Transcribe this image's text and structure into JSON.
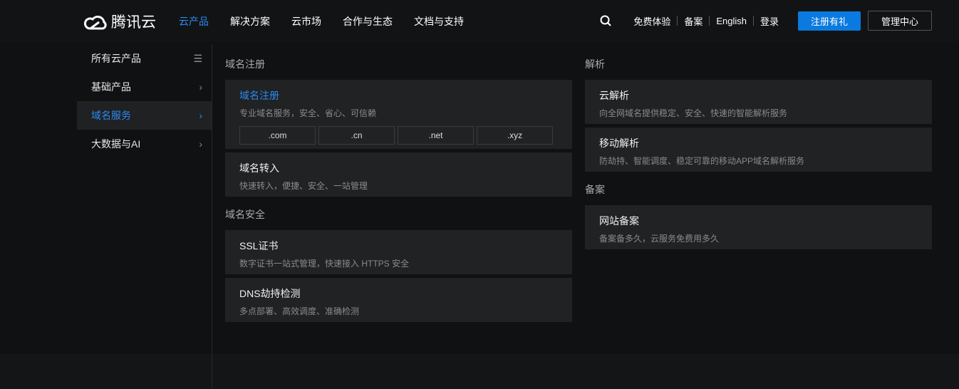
{
  "header": {
    "logo_text": "腾讯云",
    "nav": [
      "云产品",
      "解决方案",
      "云市场",
      "合作与生态",
      "文档与支持"
    ],
    "links": [
      "免费体验",
      "备案",
      "English",
      "登录"
    ],
    "register": "注册有礼",
    "console": "管理中心"
  },
  "sidebar": [
    {
      "label": "所有云产品",
      "icon": "menu-icon"
    },
    {
      "label": "基础产品",
      "icon": "chevron-right-icon"
    },
    {
      "label": "域名服务",
      "icon": "chevron-right-icon"
    },
    {
      "label": "大数据与AI",
      "icon": "chevron-right-icon"
    }
  ],
  "left": {
    "sec1": "域名注册",
    "reg": {
      "title": "域名注册",
      "desc": "专业域名服务，安全、省心、可信赖",
      "tlds": [
        ".com",
        ".cn",
        ".net",
        ".xyz"
      ]
    },
    "transfer": {
      "title": "域名转入",
      "desc": "快速转入，便捷、安全、一站管理"
    },
    "sec2": "域名安全",
    "ssl": {
      "title": "SSL证书",
      "desc": "数字证书一站式管理，快速接入 HTTPS 安全"
    },
    "dns": {
      "title": "DNS劫持检测",
      "desc": "多点部署、高效调度、准确检测"
    }
  },
  "right": {
    "sec1": "解析",
    "cloud": {
      "title": "云解析",
      "desc": "向全网域名提供稳定、安全、快速的智能解析服务"
    },
    "mobile": {
      "title": "移动解析",
      "desc": "防劫持、智能调度、稳定可靠的移动APP域名解析服务"
    },
    "sec2": "备案",
    "icp": {
      "title": "网站备案",
      "desc": "备案备多久，云服务免费用多久"
    }
  },
  "colors": {
    "accent": "#2b8bf2",
    "button": "#0a79e0"
  }
}
